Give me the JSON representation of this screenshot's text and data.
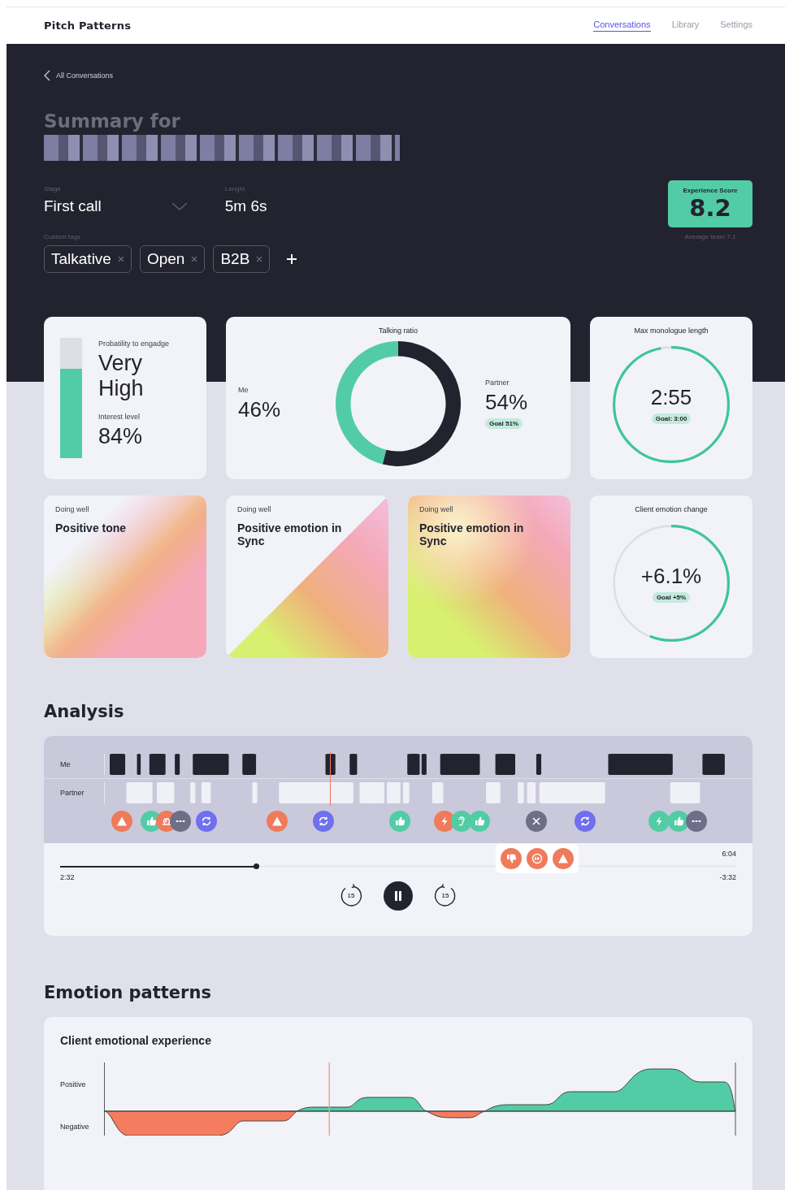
{
  "app": {
    "title": "Pitch Patterns"
  },
  "nav": [
    {
      "label": "Conversations",
      "selected": true
    },
    {
      "label": "Library",
      "selected": false
    },
    {
      "label": "Settings",
      "selected": false
    }
  ],
  "back_link": "All Conversations",
  "summary": {
    "title": "Summary for",
    "stage": {
      "label": "Stage",
      "value": "First call"
    },
    "length": {
      "label": "Lenght",
      "value": "5m 6s"
    },
    "custom_tags": {
      "label": "Custom tags",
      "tags": [
        "Talkative",
        "Open",
        "B2B"
      ]
    },
    "experience_score": {
      "label": "Experience Score",
      "value": "8.2",
      "note": "Average team 7.1"
    }
  },
  "engagement": {
    "title": "Probatility to engadge",
    "value": "Very High",
    "interest_label": "Interest level",
    "interest_value": "84%",
    "level": 0.74
  },
  "talking_ratio": {
    "title": "Talking ratio",
    "me_value": "46%",
    "partner_value": "54%",
    "goal": "Goal 51%",
    "chart_data": {
      "type": "donut",
      "categories": [
        "Me",
        "Partner"
      ],
      "values": [
        46,
        54
      ],
      "colors": [
        "#52cca4",
        "#23232f"
      ]
    }
  },
  "monologue": {
    "title": "Max monologue length",
    "value": "2:55",
    "goal": "Goal: 3:00",
    "level": 0.97
  },
  "highlights": [
    {
      "kind": "blend",
      "status": "Doing well",
      "title": "Positive tone"
    },
    {
      "kind": "diagonal",
      "status": "Doing well",
      "title": "Positive emotion in Sync"
    },
    {
      "kind": "full",
      "status": "Doing well",
      "title": "Positive emotion in Sync"
    }
  ],
  "emotion_change": {
    "title": "Client emotion change",
    "value": "+6.1%",
    "goal": "Goal +5%",
    "level": 0.56
  },
  "analysis": {
    "title": "Analysis",
    "speakers": [
      "Me",
      "Partner"
    ],
    "markers": [
      {
        "kind": "warning",
        "color": "#f07a5c"
      },
      {
        "kind": "thumbs-up",
        "color": "#52cca4"
      },
      {
        "kind": "snail",
        "color": "#f07a5c"
      },
      {
        "kind": "more",
        "color": "#6e6e88"
      },
      {
        "kind": "sync",
        "color": "#6f6ff0"
      },
      {
        "kind": "warning",
        "color": "#f07a5c"
      },
      {
        "kind": "sync",
        "color": "#6f6ff0"
      },
      {
        "kind": "thumbs-up",
        "color": "#52cca4"
      },
      {
        "kind": "bolt",
        "color": "#f07a5c"
      },
      {
        "kind": "ear",
        "color": "#52cca4"
      },
      {
        "kind": "thumbs-up",
        "color": "#52cca4"
      },
      {
        "kind": "close",
        "color": "#6e6e88"
      },
      {
        "kind": "sync",
        "color": "#6f6ff0"
      },
      {
        "kind": "bolt",
        "color": "#52cca4"
      },
      {
        "kind": "thumbs-up",
        "color": "#52cca4"
      },
      {
        "kind": "more",
        "color": "#6e6e88"
      }
    ],
    "popup": [
      {
        "kind": "thumbs-down"
      },
      {
        "kind": "fast-forward"
      },
      {
        "kind": "warning"
      }
    ],
    "player": {
      "total": "6:04",
      "elapsed": "2:32",
      "remaining": "-3:32",
      "level": 0.29,
      "skip_back": "15",
      "skip_forward": "15",
      "playing": true
    }
  },
  "emotion_patterns": {
    "title": "Emotion patterns",
    "card_title": "Client emotional experience",
    "axis_labels": [
      "Positive",
      "Negative"
    ]
  }
}
